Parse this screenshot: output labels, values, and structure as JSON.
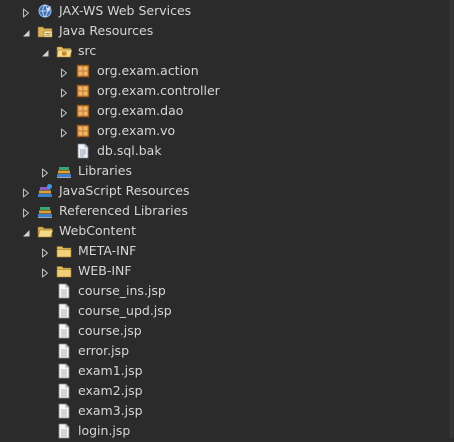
{
  "tree": [
    {
      "label": "JAX-WS Web Services",
      "depth": 0,
      "expanded": false,
      "icon": "web-services-icon"
    },
    {
      "label": "Java Resources",
      "depth": 0,
      "expanded": true,
      "icon": "java-resources-icon"
    },
    {
      "label": "src",
      "depth": 1,
      "expanded": true,
      "icon": "source-folder-icon"
    },
    {
      "label": "org.exam.action",
      "depth": 2,
      "expanded": false,
      "icon": "package-icon"
    },
    {
      "label": "org.exam.controller",
      "depth": 2,
      "expanded": false,
      "icon": "package-icon"
    },
    {
      "label": "org.exam.dao",
      "depth": 2,
      "expanded": false,
      "icon": "package-icon"
    },
    {
      "label": "org.exam.vo",
      "depth": 2,
      "expanded": false,
      "icon": "package-icon"
    },
    {
      "label": "db.sql.bak",
      "depth": 2,
      "expanded": null,
      "icon": "file-icon"
    },
    {
      "label": "Libraries",
      "depth": 1,
      "expanded": false,
      "icon": "library-icon"
    },
    {
      "label": "JavaScript Resources",
      "depth": 0,
      "expanded": false,
      "icon": "javascript-resources-icon"
    },
    {
      "label": "Referenced Libraries",
      "depth": 0,
      "expanded": false,
      "icon": "library-icon"
    },
    {
      "label": "WebContent",
      "depth": 0,
      "expanded": true,
      "icon": "folder-open-icon"
    },
    {
      "label": "META-INF",
      "depth": 1,
      "expanded": false,
      "icon": "folder-icon"
    },
    {
      "label": "WEB-INF",
      "depth": 1,
      "expanded": false,
      "icon": "folder-icon"
    },
    {
      "label": "course_ins.jsp",
      "depth": 1,
      "expanded": null,
      "icon": "jsp-file-icon"
    },
    {
      "label": "course_upd.jsp",
      "depth": 1,
      "expanded": null,
      "icon": "jsp-file-icon"
    },
    {
      "label": "course.jsp",
      "depth": 1,
      "expanded": null,
      "icon": "jsp-file-icon"
    },
    {
      "label": "error.jsp",
      "depth": 1,
      "expanded": null,
      "icon": "jsp-file-icon"
    },
    {
      "label": "exam1.jsp",
      "depth": 1,
      "expanded": null,
      "icon": "jsp-file-icon"
    },
    {
      "label": "exam2.jsp",
      "depth": 1,
      "expanded": null,
      "icon": "jsp-file-icon"
    },
    {
      "label": "exam3.jsp",
      "depth": 1,
      "expanded": null,
      "icon": "jsp-file-icon"
    },
    {
      "label": "login.jsp",
      "depth": 1,
      "expanded": null,
      "icon": "jsp-file-icon"
    }
  ],
  "colors": {
    "background": "#2b2b2b",
    "text": "#d6d6d6",
    "twisty": "#bdbdbd"
  }
}
